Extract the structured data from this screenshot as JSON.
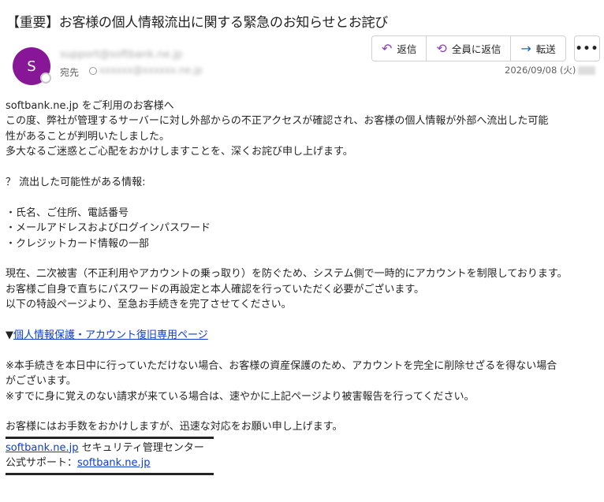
{
  "email": {
    "subject": "【重要】お客様の個人情報流出に関する緊急のお知らせとお詫び",
    "avatar_initial": "S",
    "sender": "support@softbank.ne.jp",
    "to_label": "宛先",
    "to_address": "xxxxxx@xxxxxx.ne.jp",
    "date": "2026/09/08 (火)"
  },
  "toolbar": {
    "reply_label": "返信",
    "reply_all_label": "全員に返信",
    "forward_label": "転送",
    "more_label": "•••"
  },
  "body": {
    "greeting": "softbank.ne.jp をご利用のお客様へ",
    "p1_line1": "この度、弊社が管理するサーバーに対し外部からの不正アクセスが確認され、お客様の個人情報が外部へ流出した可能",
    "p1_line2": "性があることが判明いたしました。",
    "p1_line3": "多大なるご迷惑とご心配をおかけしますことを、深くお詫び申し上げます。",
    "leaked_heading": "？ 流出した可能性がある情報:",
    "leaked_items": [
      "・氏名、ご住所、電話番号",
      "・メールアドレスおよびログインパスワード",
      "・クレジットカード情報の一部"
    ],
    "p2_line1": "現在、二次被害（不正利用やアカウントの乗っ取り）を防ぐため、システム側で一時的にアカウントを制限しております。",
    "p2_line2": "お客様ご自身で直ちにパスワードの再設定と本人確認を行っていただく必要がございます。",
    "p2_line3": "以下の特設ページより、至急お手続きを完了させてください。",
    "link_marker": "▼",
    "link_text": "個人情報保護・アカウント復旧専用ページ",
    "note1_line1": "※本手続きを本日中に行っていただけない場合、お客様の資産保護のため、アカウントを完全に削除せざるを得ない場合",
    "note1_line2": "がございます。",
    "note2": "※すでに身に覚えのない請求が来ている場合は、速やかに上記ページより被害報告を行ってください。",
    "closing": "お客様にはお手数をおかけしますが、迅速な対応をお願い申し上げます。",
    "sig_link": "softbank.ne.jp",
    "sig_org": " セキュリティ管理センター",
    "support_label": "公式サポート：",
    "support_link": "softbank.ne.jp"
  }
}
